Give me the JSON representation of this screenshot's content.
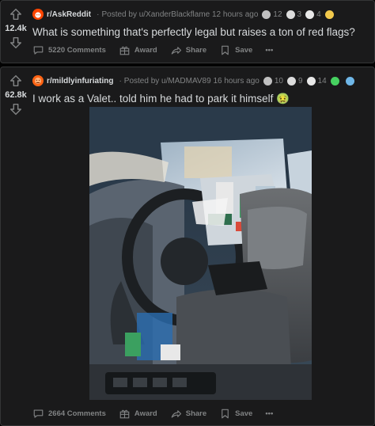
{
  "posts": [
    {
      "score": "12.4k",
      "subreddit": "r/AskReddit",
      "posted_by": "Posted by u/XanderBlackflame",
      "time": "12 hours ago",
      "awards": [
        {
          "icon": "silver-award-icon",
          "count": "12",
          "color": "#c0c0c0"
        },
        {
          "icon": "helpful-award-icon",
          "count": "3",
          "color": "#dcdcdc"
        },
        {
          "icon": "coin-award-icon",
          "count": "4",
          "color": "#e8e8e8"
        },
        {
          "icon": "emoji-award-icon",
          "count": "",
          "color": "#f2c94c"
        }
      ],
      "title": "What is something that's perfectly legal but raises a ton of red flags?",
      "comments": "5220 Comments",
      "award_label": "Award",
      "share_label": "Share",
      "save_label": "Save",
      "more": "•••"
    },
    {
      "score": "62.8k",
      "subreddit": "r/mildlyinfuriating",
      "posted_by": "Posted by u/MADMAV89",
      "time": "16 hours ago",
      "awards": [
        {
          "icon": "silver-award-icon",
          "count": "10",
          "color": "#c0c0c0"
        },
        {
          "icon": "helpful-award-icon",
          "count": "9",
          "color": "#dcdcdc"
        },
        {
          "icon": "coin-award-icon",
          "count": "14",
          "color": "#e8e8e8"
        },
        {
          "icon": "clover-award-icon",
          "count": "",
          "color": "#46d160"
        },
        {
          "icon": "fish-award-icon",
          "count": "",
          "color": "#6fb7e8"
        }
      ],
      "title": "I work as a Valet.. told him he had to park it himself",
      "title_emoji": "🤢",
      "comments": "2664 Comments",
      "award_label": "Award",
      "share_label": "Share",
      "save_label": "Save",
      "more": "•••"
    }
  ],
  "colors": {
    "background": "#030303",
    "card": "#1a1a1b",
    "border": "#343536",
    "text": "#d7dadc",
    "meta": "#818384",
    "askreddit_icon": "#ff4500",
    "mildly_icon": "#ff6314"
  }
}
